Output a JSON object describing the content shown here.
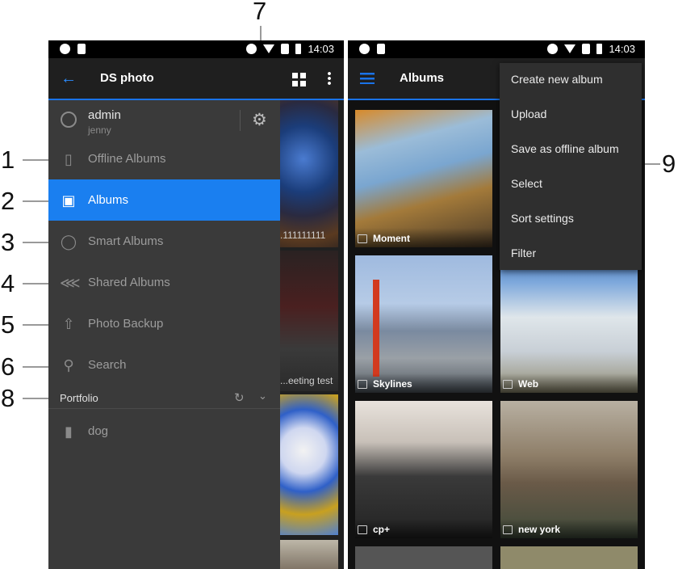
{
  "callouts": [
    "1",
    "2",
    "3",
    "4",
    "5",
    "6",
    "7",
    "8",
    "9"
  ],
  "status_bar": {
    "time": "14:03"
  },
  "left_screen": {
    "app_title": "DS photo",
    "user": {
      "name": "admin",
      "sub": "jenny"
    },
    "nav_items": [
      {
        "label": "Offline Albums",
        "icon": "tablet-icon"
      },
      {
        "label": "Albums",
        "icon": "albums-icon",
        "active": true
      },
      {
        "label": "Smart Albums",
        "icon": "lightbulb-icon"
      },
      {
        "label": "Shared Albums",
        "icon": "share-icon"
      },
      {
        "label": "Photo Backup",
        "icon": "upload-icon"
      },
      {
        "label": "Search",
        "icon": "search-icon"
      }
    ],
    "portfolio": {
      "label": "Portfolio",
      "items": [
        {
          "label": "dog",
          "icon": "bookmark-icon"
        }
      ]
    },
    "peek_texts": [
      ".111111111",
      "...eeting test"
    ]
  },
  "right_screen": {
    "title": "Albums",
    "albums": [
      "Moment",
      "Skylines",
      "Web",
      "cp+",
      "new york"
    ],
    "menu_items": [
      "Create new album",
      "Upload",
      "Save as offline album",
      "Select",
      "Sort settings",
      "Filter"
    ]
  }
}
